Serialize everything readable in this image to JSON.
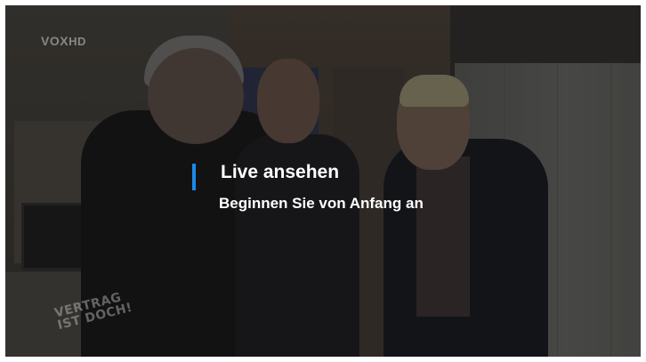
{
  "channel": {
    "logo_text": "VOX",
    "hd_label": "HD"
  },
  "show": {
    "watermark_line1": "VERTRAG",
    "watermark_line2": "IST DOCH!"
  },
  "menu": {
    "items": [
      {
        "label": "Live ansehen",
        "focused": true
      },
      {
        "label": "Beginnen Sie von Anfang an",
        "focused": false
      }
    ],
    "accent_color": "#1e88e5"
  }
}
